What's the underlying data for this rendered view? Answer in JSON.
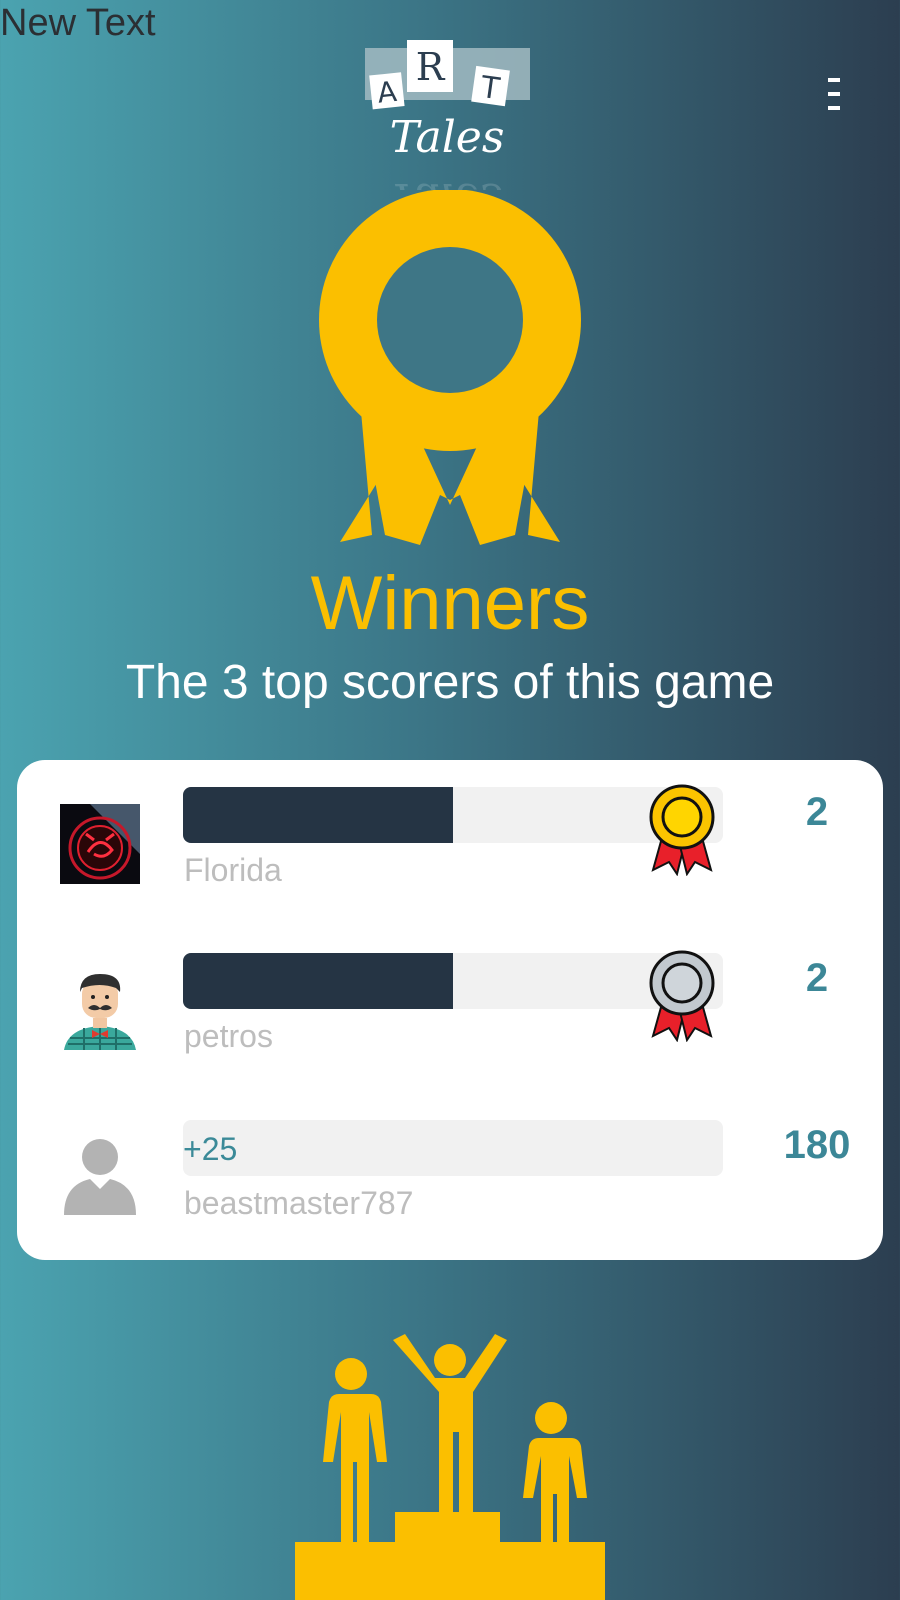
{
  "debug_label": "New Text",
  "logo": {
    "letters": [
      "A",
      "R",
      "T"
    ],
    "word": "Tales"
  },
  "colors": {
    "gold": "#fbbf00",
    "silver": "#c2c9cf",
    "ribbon": "#e8202a",
    "bar_fill": "#253444",
    "score": "#3c8797"
  },
  "hero": {
    "title": "Winners",
    "subtitle": "The 3 top scorers of this game"
  },
  "leaderboard": {
    "rows": [
      {
        "name": "Florida",
        "score": "2",
        "bar_label": "",
        "progress": 0.5,
        "medal": "gold-medal-icon",
        "avatar": "scorpion-avatar"
      },
      {
        "name": "petros",
        "score": "2",
        "bar_label": "",
        "progress": 0.5,
        "medal": "silver-medal-icon",
        "avatar": "mustache-man-avatar"
      },
      {
        "name": "beastmaster787",
        "score": "180",
        "bar_label": "+25",
        "progress": 0,
        "medal": "",
        "avatar": "default-user-avatar"
      }
    ]
  },
  "icons": {
    "menu": "menu-icon",
    "hero": "award-ribbon-icon",
    "footer": "podium-icon"
  }
}
